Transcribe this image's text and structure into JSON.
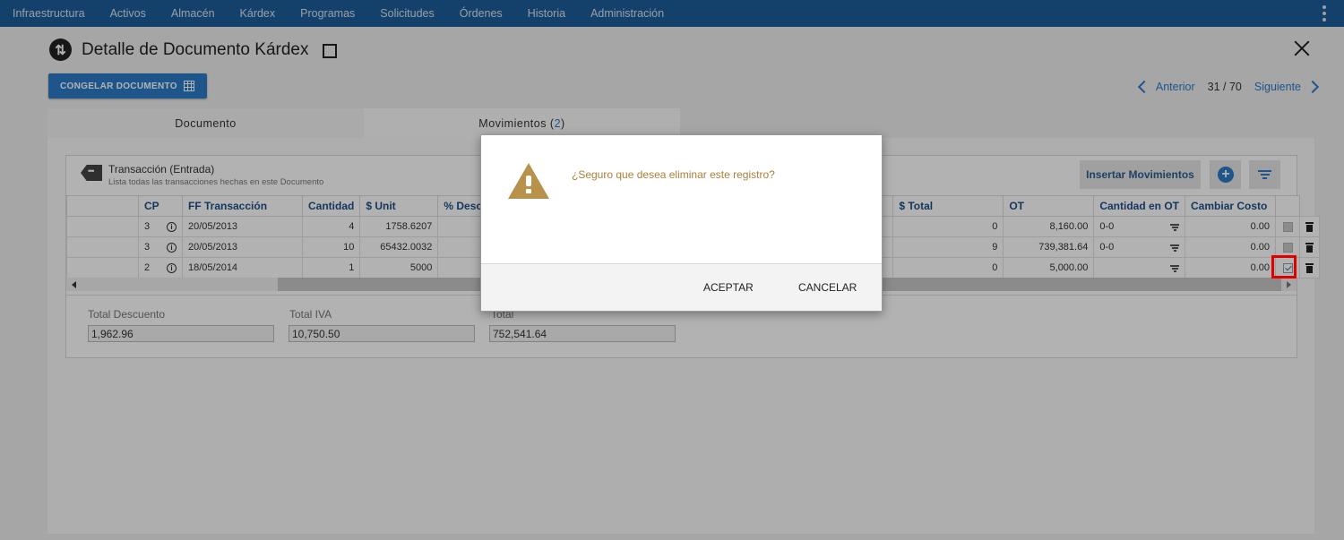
{
  "nav": {
    "items": [
      "Infraestructura",
      "Activos",
      "Almacén",
      "Kárdex",
      "Programas",
      "Solicitudes",
      "Órdenes",
      "Historia",
      "Administración"
    ]
  },
  "header": {
    "title": "Detalle de Documento Kárdex",
    "freeze_label": "CONGELAR DOCUMENTO"
  },
  "pager": {
    "prev": "Anterior",
    "count": "31 / 70",
    "next": "Siguiente"
  },
  "tabs": {
    "documento": "Documento",
    "movimientos_label": "Movimientos",
    "movimientos_count": "2"
  },
  "card": {
    "title": "Transacción (Entrada)",
    "subtitle": "Lista todas las transacciones hechas en este Documento",
    "insert_label": "Insertar Movimientos"
  },
  "table": {
    "headers": [
      "CP",
      "FF Transacción",
      "Cantidad",
      "$ Unit",
      "% Desc",
      "$ Total",
      "OT",
      "Cantidad en OT",
      "Cambiar Costo"
    ],
    "rows": [
      {
        "cp": "3",
        "fecha": "20/05/2013",
        "cantidad": "4",
        "unit": "1758.6207",
        "hidden_tail": "0",
        "total": "8,160.00",
        "ot": "0-0",
        "cant_ot": "0.00",
        "cambiar": false
      },
      {
        "cp": "3",
        "fecha": "20/05/2013",
        "cantidad": "10",
        "unit": "65432.0032",
        "hidden_tail": "9",
        "total": "739,381.64",
        "ot": "0-0",
        "cant_ot": "0.00",
        "cambiar": false
      },
      {
        "cp": "2",
        "fecha": "18/05/2014",
        "cantidad": "1",
        "unit": "5000",
        "hidden_tail": "0",
        "total": "5,000.00",
        "ot": "",
        "cant_ot": "0.00",
        "cambiar": true
      }
    ]
  },
  "totals": {
    "descuento_label": "Total Descuento",
    "descuento_value": "1,962.96",
    "iva_label": "Total IVA",
    "iva_value": "10,750.50",
    "total_label": "Total",
    "total_value": "752,541.64"
  },
  "modal": {
    "message": "¿Seguro que desea eliminar este registro?",
    "accept": "ACEPTAR",
    "cancel": "CANCELAR"
  },
  "colors": {
    "nav_bg": "#1e5d9a",
    "accent": "#2b7cc9",
    "warning": "#b8914a",
    "highlight": "#e00000"
  }
}
